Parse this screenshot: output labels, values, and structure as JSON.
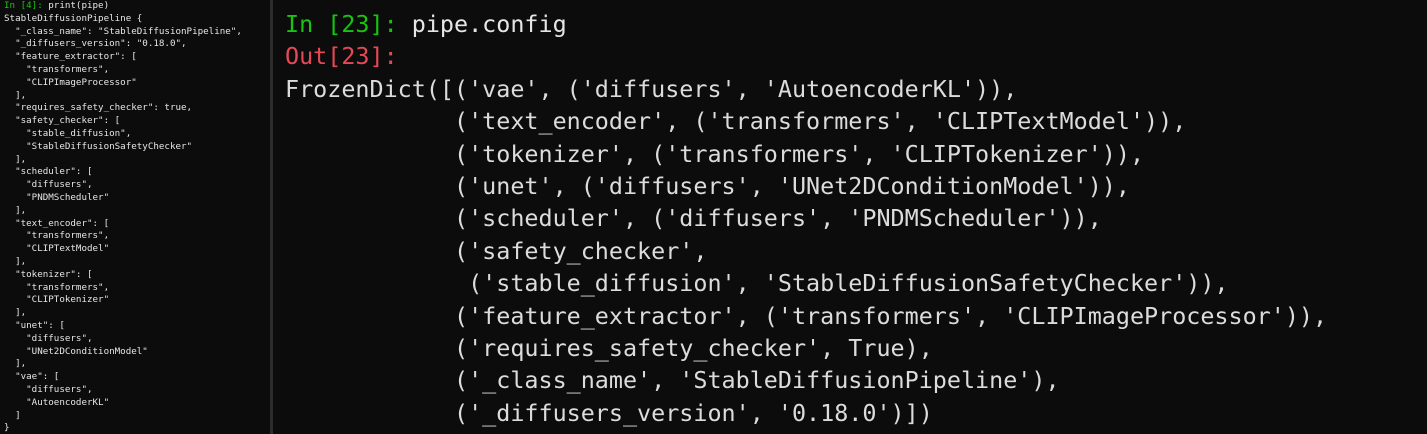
{
  "colors": {
    "background": "#0c0c0c",
    "text": "#e6e6e6",
    "in_prompt": "#16c60c",
    "out_prompt": "#e74856",
    "divider": "#2c2c2c"
  },
  "left_pane": {
    "prompt": "In [4]:",
    "command": " print(pipe)",
    "lines": [
      "StableDiffusionPipeline {",
      "  \"_class_name\": \"StableDiffusionPipeline\",",
      "  \"_diffusers_version\": \"0.18.0\",",
      "  \"feature_extractor\": [",
      "    \"transformers\",",
      "    \"CLIPImageProcessor\"",
      "  ],",
      "  \"requires_safety_checker\": true,",
      "  \"safety_checker\": [",
      "    \"stable_diffusion\",",
      "    \"StableDiffusionSafetyChecker\"",
      "  ],",
      "  \"scheduler\": [",
      "    \"diffusers\",",
      "    \"PNDMScheduler\"",
      "  ],",
      "  \"text_encoder\": [",
      "    \"transformers\",",
      "    \"CLIPTextModel\"",
      "  ],",
      "  \"tokenizer\": [",
      "    \"transformers\",",
      "    \"CLIPTokenizer\"",
      "  ],",
      "  \"unet\": [",
      "    \"diffusers\",",
      "    \"UNet2DConditionModel\"",
      "  ],",
      "  \"vae\": [",
      "    \"diffusers\",",
      "    \"AutoencoderKL\"",
      "  ]",
      "}"
    ]
  },
  "right_pane": {
    "in_prompt": "In [23]:",
    "command": " pipe.config",
    "out_prompt": "Out[23]:",
    "output_lines": [
      "FrozenDict([('vae', ('diffusers', 'AutoencoderKL')),",
      "            ('text_encoder', ('transformers', 'CLIPTextModel')),",
      "            ('tokenizer', ('transformers', 'CLIPTokenizer')),",
      "            ('unet', ('diffusers', 'UNet2DConditionModel')),",
      "            ('scheduler', ('diffusers', 'PNDMScheduler')),",
      "            ('safety_checker',",
      "             ('stable_diffusion', 'StableDiffusionSafetyChecker')),",
      "            ('feature_extractor', ('transformers', 'CLIPImageProcessor')),",
      "            ('requires_safety_checker', True),",
      "            ('_class_name', 'StableDiffusionPipeline'),",
      "            ('_diffusers_version', '0.18.0')])"
    ]
  }
}
